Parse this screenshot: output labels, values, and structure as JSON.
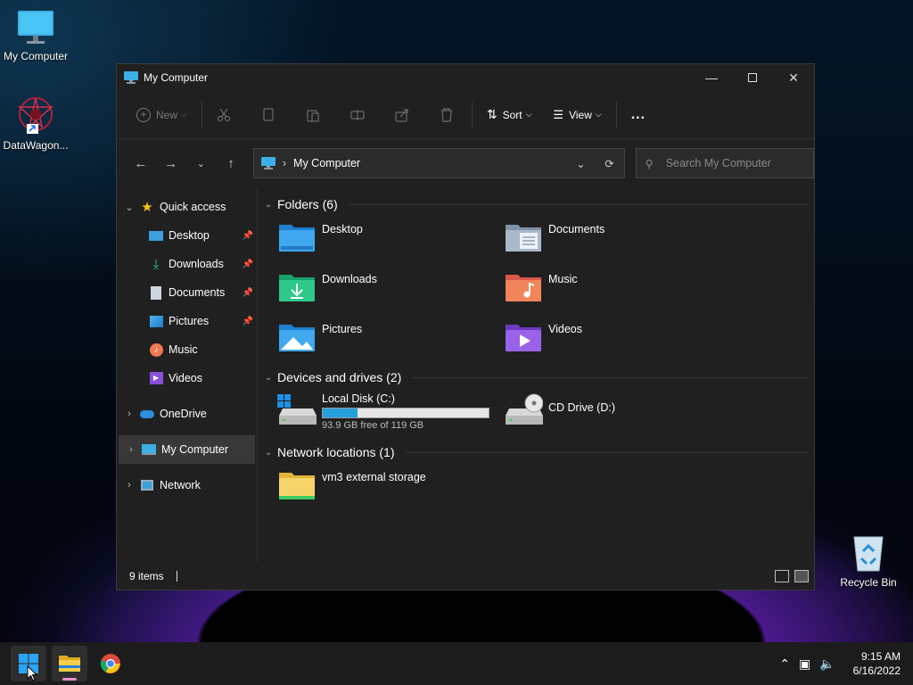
{
  "desktop": {
    "icons": [
      {
        "label": "My Computer"
      },
      {
        "label": "DataWagon..."
      },
      {
        "label": "Recycle Bin"
      }
    ]
  },
  "window": {
    "title": "My Computer",
    "commands": {
      "new": "New",
      "sort": "Sort",
      "view": "View",
      "more": "..."
    },
    "address": {
      "location": "My Computer"
    },
    "search": {
      "placeholder": "Search My Computer"
    }
  },
  "sidebar": {
    "quick_access": "Quick access",
    "quick_items": [
      {
        "label": "Desktop",
        "icon": "desktop-icon"
      },
      {
        "label": "Downloads",
        "icon": "downloads-icon"
      },
      {
        "label": "Documents",
        "icon": "documents-icon"
      },
      {
        "label": "Pictures",
        "icon": "pictures-icon"
      },
      {
        "label": "Music",
        "icon": "music-icon"
      },
      {
        "label": "Videos",
        "icon": "videos-icon"
      }
    ],
    "onedrive": "OneDrive",
    "my_computer": "My Computer",
    "network": "Network"
  },
  "main": {
    "folders_header": "Folders (6)",
    "folders": [
      {
        "name": "Desktop",
        "icon": "desktop-folder-icon"
      },
      {
        "name": "Documents",
        "icon": "documents-folder-icon"
      },
      {
        "name": "Downloads",
        "icon": "downloads-folder-icon"
      },
      {
        "name": "Music",
        "icon": "music-folder-icon"
      },
      {
        "name": "Pictures",
        "icon": "pictures-folder-icon"
      },
      {
        "name": "Videos",
        "icon": "videos-folder-icon"
      }
    ],
    "drives_header": "Devices and drives (2)",
    "drives": [
      {
        "name": "Local Disk (C:)",
        "free_text": "93.9 GB free of 119 GB",
        "used_fraction": 0.21
      },
      {
        "name": "CD Drive (D:)"
      }
    ],
    "network_header": "Network locations (1)",
    "network_locations": [
      {
        "name": "vm3 external storage"
      }
    ]
  },
  "status": {
    "items": "9 items"
  },
  "taskbar": {
    "time": "9:15 AM",
    "date": "6/16/2022"
  },
  "colors": {
    "accent": "#26a0da",
    "window_bg": "#202020",
    "taskbar_bg": "#1c1c1c"
  }
}
